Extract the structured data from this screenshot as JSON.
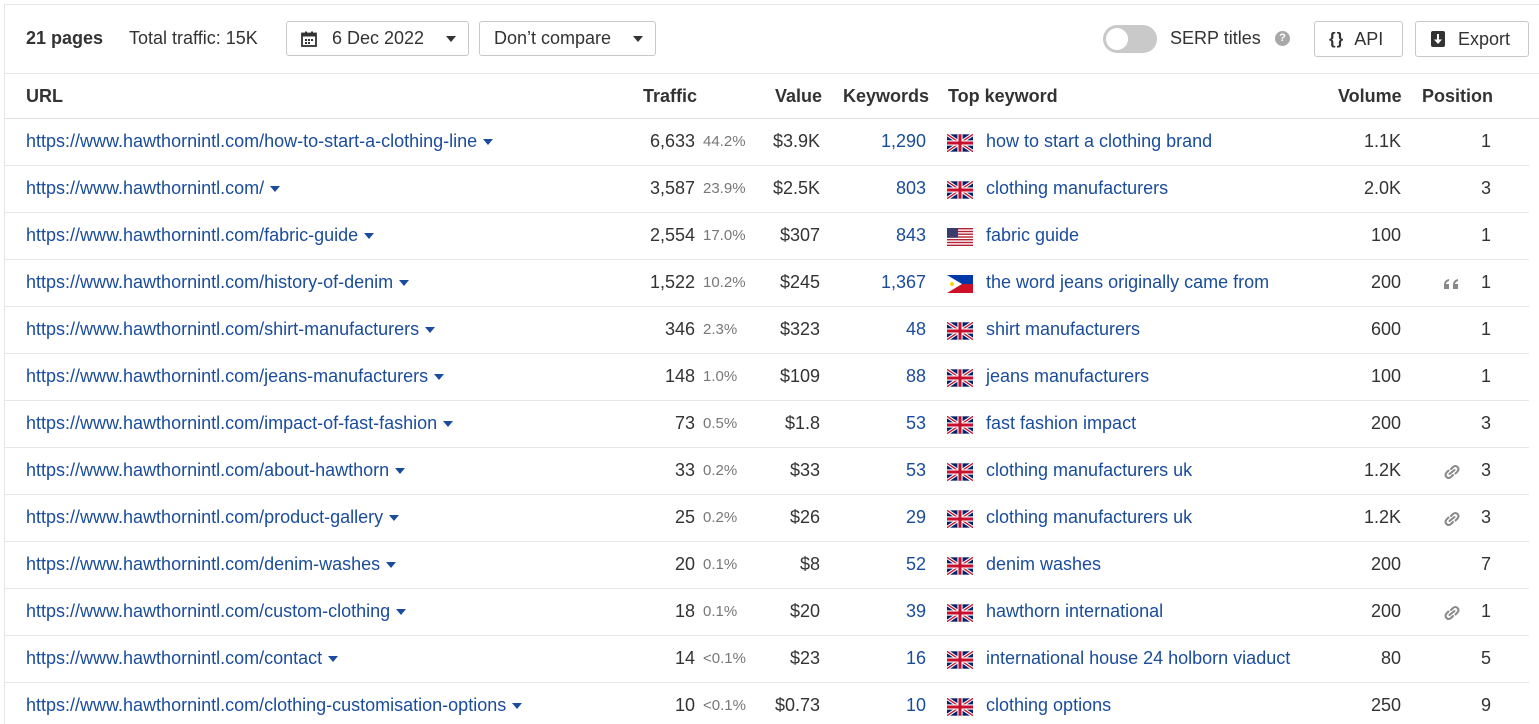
{
  "toolbar": {
    "pages": "21 pages",
    "total_traffic": "Total traffic: 15K",
    "date": "6 Dec 2022",
    "compare": "Don’t compare",
    "serp_titles": "SERP titles",
    "serp_toggle_on": false,
    "api": "API",
    "export": "Export"
  },
  "columns": {
    "url": "URL",
    "traffic": "Traffic",
    "value": "Value",
    "keywords": "Keywords",
    "top_keyword": "Top keyword",
    "volume": "Volume",
    "position": "Position"
  },
  "rows": [
    {
      "url": "https://www.hawthornintl.com/how-to-start-a-clothing-line",
      "traffic": "6,633",
      "pct": "44.2%",
      "value": "$3.9K",
      "keywords": "1,290",
      "flag": "uk",
      "top_keyword": "how to start a clothing brand",
      "volume": "1.1K",
      "feature": "",
      "position": "1"
    },
    {
      "url": "https://www.hawthornintl.com/",
      "traffic": "3,587",
      "pct": "23.9%",
      "value": "$2.5K",
      "keywords": "803",
      "flag": "uk",
      "top_keyword": "clothing manufacturers",
      "volume": "2.0K",
      "feature": "",
      "position": "3"
    },
    {
      "url": "https://www.hawthornintl.com/fabric-guide",
      "traffic": "2,554",
      "pct": "17.0%",
      "value": "$307",
      "keywords": "843",
      "flag": "us",
      "top_keyword": "fabric guide",
      "volume": "100",
      "feature": "",
      "position": "1"
    },
    {
      "url": "https://www.hawthornintl.com/history-of-denim",
      "traffic": "1,522",
      "pct": "10.2%",
      "value": "$245",
      "keywords": "1,367",
      "flag": "ph",
      "top_keyword": "the word jeans originally came from",
      "volume": "200",
      "feature": "quote",
      "position": "1"
    },
    {
      "url": "https://www.hawthornintl.com/shirt-manufacturers",
      "traffic": "346",
      "pct": "2.3%",
      "value": "$323",
      "keywords": "48",
      "flag": "uk",
      "top_keyword": "shirt manufacturers",
      "volume": "600",
      "feature": "",
      "position": "1"
    },
    {
      "url": "https://www.hawthornintl.com/jeans-manufacturers",
      "traffic": "148",
      "pct": "1.0%",
      "value": "$109",
      "keywords": "88",
      "flag": "uk",
      "top_keyword": "jeans manufacturers",
      "volume": "100",
      "feature": "",
      "position": "1"
    },
    {
      "url": "https://www.hawthornintl.com/impact-of-fast-fashion",
      "traffic": "73",
      "pct": "0.5%",
      "value": "$1.8",
      "keywords": "53",
      "flag": "uk",
      "top_keyword": "fast fashion impact",
      "volume": "200",
      "feature": "",
      "position": "3"
    },
    {
      "url": "https://www.hawthornintl.com/about-hawthorn",
      "traffic": "33",
      "pct": "0.2%",
      "value": "$33",
      "keywords": "53",
      "flag": "uk",
      "top_keyword": "clothing manufacturers uk",
      "volume": "1.2K",
      "feature": "link",
      "position": "3"
    },
    {
      "url": "https://www.hawthornintl.com/product-gallery",
      "traffic": "25",
      "pct": "0.2%",
      "value": "$26",
      "keywords": "29",
      "flag": "uk",
      "top_keyword": "clothing manufacturers uk",
      "volume": "1.2K",
      "feature": "link",
      "position": "3"
    },
    {
      "url": "https://www.hawthornintl.com/denim-washes",
      "traffic": "20",
      "pct": "0.1%",
      "value": "$8",
      "keywords": "52",
      "flag": "uk",
      "top_keyword": "denim washes",
      "volume": "200",
      "feature": "",
      "position": "7"
    },
    {
      "url": "https://www.hawthornintl.com/custom-clothing",
      "traffic": "18",
      "pct": "0.1%",
      "value": "$20",
      "keywords": "39",
      "flag": "uk",
      "top_keyword": "hawthorn international",
      "volume": "200",
      "feature": "link",
      "position": "1"
    },
    {
      "url": "https://www.hawthornintl.com/contact",
      "traffic": "14",
      "pct": "<0.1%",
      "value": "$23",
      "keywords": "16",
      "flag": "uk",
      "top_keyword": "international house 24 holborn viaduct",
      "volume": "80",
      "feature": "",
      "position": "5"
    },
    {
      "url": "https://www.hawthornintl.com/clothing-customisation-options",
      "traffic": "10",
      "pct": "<0.1%",
      "value": "$0.73",
      "keywords": "10",
      "flag": "uk",
      "top_keyword": "clothing options",
      "volume": "250",
      "feature": "",
      "position": "9"
    }
  ]
}
